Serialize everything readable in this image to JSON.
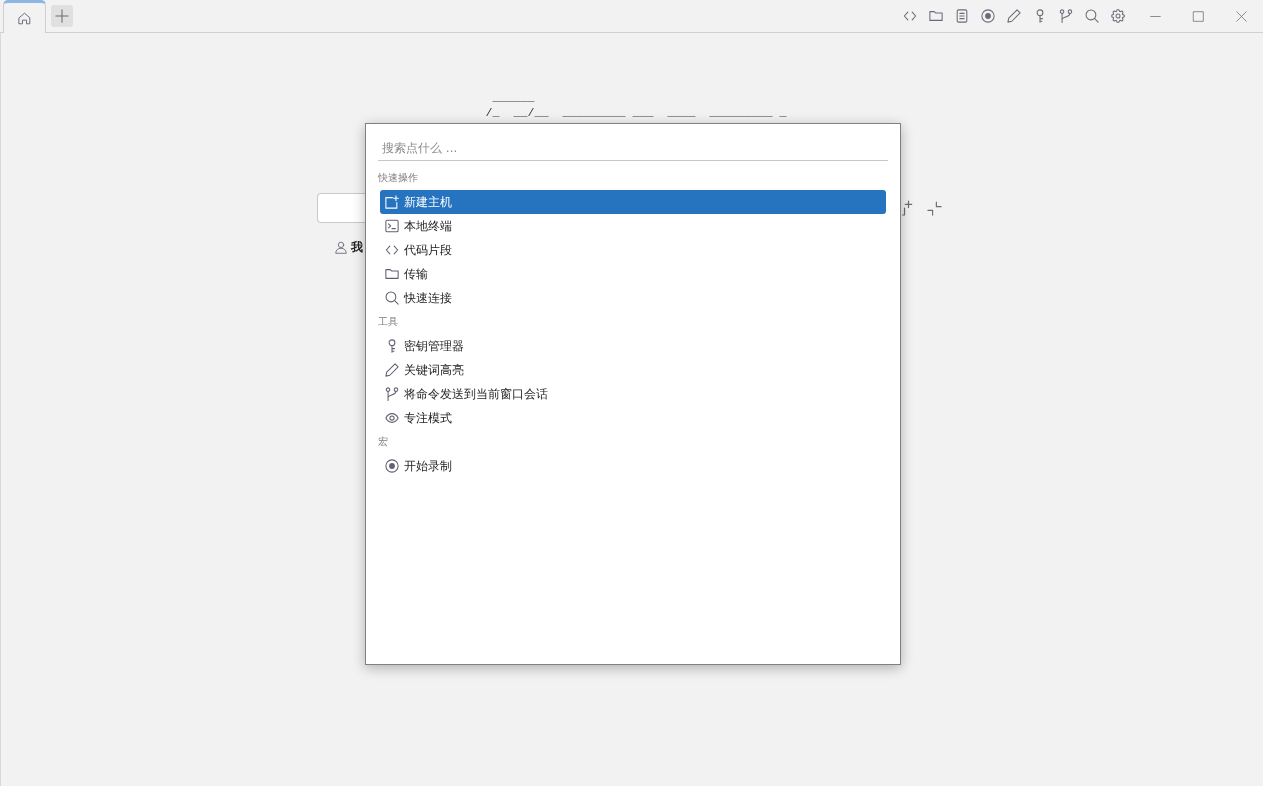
{
  "tabs": [
    {
      "selected": true
    }
  ],
  "logo": {
    "lines": [
      " ______",
      "/_  __/__  _________ ___  ____  _________ _"
    ]
  },
  "user": {
    "label": "我"
  },
  "command_palette": {
    "search": {
      "placeholder": "搜索点什么 ..."
    },
    "sections": [
      {
        "title": "快速操作",
        "items": [
          {
            "label": "新建主机",
            "selected": true
          },
          {
            "label": "本地终端",
            "selected": false
          },
          {
            "label": "代码片段",
            "selected": false
          },
          {
            "label": "传输",
            "selected": false
          },
          {
            "label": "快速连接",
            "selected": false
          }
        ]
      },
      {
        "title": "工具",
        "items": [
          {
            "label": "密钥管理器",
            "selected": false
          },
          {
            "label": "关键词高亮",
            "selected": false
          },
          {
            "label": "将命令发送到当前窗口会话",
            "selected": false
          },
          {
            "label": "专注模式",
            "selected": false
          }
        ]
      },
      {
        "title": "宏",
        "items": [
          {
            "label": "开始录制",
            "selected": false
          }
        ]
      }
    ]
  }
}
